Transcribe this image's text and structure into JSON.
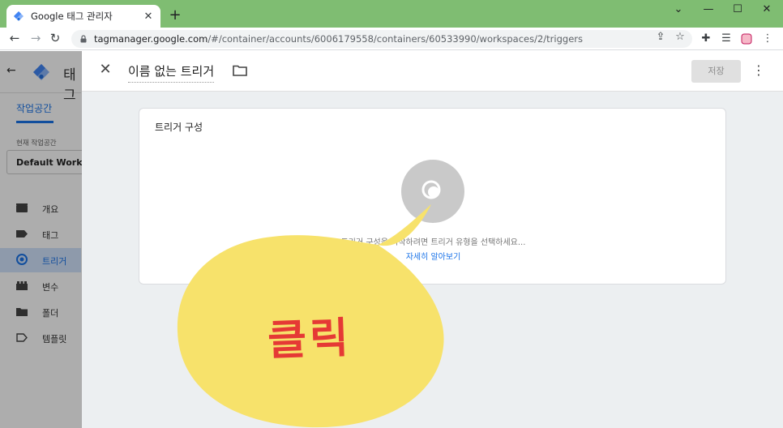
{
  "browser": {
    "tab_title": "Google 태그 관리자",
    "tab_close": "✕",
    "new_tab": "+",
    "url_host": "tagmanager.google.com",
    "url_path": "/#/container/accounts/6006179558/containers/60533990/workspaces/2/triggers",
    "minimize": "⌄",
    "restore": "—",
    "maximize": "☐",
    "close": "✕"
  },
  "app": {
    "title": "태그",
    "workspace_tab": "작업공간",
    "current_workspace_label": "현재 작업공간",
    "workspace_name": "Default Workspace",
    "sidebar": {
      "items": [
        {
          "label": "개요",
          "icon": "overview-icon"
        },
        {
          "label": "태그",
          "icon": "tag-icon"
        },
        {
          "label": "트리거",
          "icon": "trigger-icon",
          "active": true
        },
        {
          "label": "변수",
          "icon": "variables-icon"
        },
        {
          "label": "폴더",
          "icon": "folder-icon"
        },
        {
          "label": "템플릿",
          "icon": "template-icon"
        }
      ]
    }
  },
  "panel": {
    "name": "이름 없는 트리거",
    "save_label": "저장",
    "card_title": "트리거 구성",
    "hint": "트리거 구성을 시작하려면 트리거 유형을 선택하세요...",
    "learn_more": "자세히 알아보기"
  },
  "annotation": {
    "text": "클릭"
  },
  "colors": {
    "tabstrip": "#7fbd72",
    "accent": "#1a73e8",
    "bubble": "#f7e26b",
    "annotation_text": "#e53935"
  }
}
